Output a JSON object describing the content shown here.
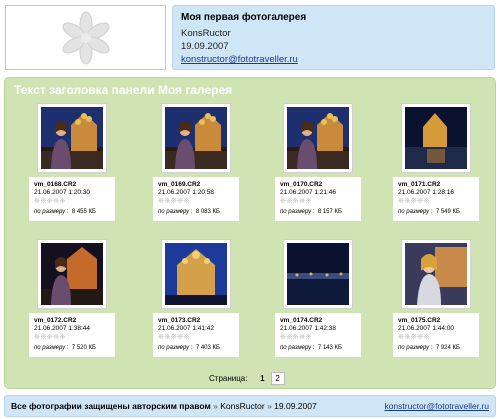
{
  "header": {
    "title": "Моя первая фотогалерея",
    "author": "KonsRuctor",
    "date": "19.09.2007",
    "email": "konstructor@fototraveller.ru"
  },
  "panel": {
    "title": "Текст заголовка панели Моя галерея",
    "size_label": "по размеру",
    "photos": [
      {
        "name": "vm_0168.CR2",
        "datetime": "21.06.2007 1:20:30",
        "size": "8 455 КБ",
        "scene": "woman-cathedral"
      },
      {
        "name": "vm_0169.CR2",
        "datetime": "21.06.2007 1:20:58",
        "size": "8 083 КБ",
        "scene": "woman-cathedral"
      },
      {
        "name": "vm_0170.CR2",
        "datetime": "21.06.2007 1:21:46",
        "size": "8 157 КБ",
        "scene": "woman-cathedral"
      },
      {
        "name": "vm_0171.CR2",
        "datetime": "21.06.2007 1:28:16",
        "size": "7 549 КБ",
        "scene": "night-canal"
      },
      {
        "name": "vm_0172.CR2",
        "datetime": "21.06.2007 1:38:44",
        "size": "7 520 КБ",
        "scene": "woman-night"
      },
      {
        "name": "vm_0173.CR2",
        "datetime": "21.06.2007 1:41:42",
        "size": "7 403 КБ",
        "scene": "cathedral-blue"
      },
      {
        "name": "vm_0174.CR2",
        "datetime": "21.06.2007 1:42:38",
        "size": "7 143 КБ",
        "scene": "night-river"
      },
      {
        "name": "vm_0175.CR2",
        "datetime": "21.06.2007 1:44:00",
        "size": "7 924 КБ",
        "scene": "woman-bright"
      }
    ],
    "pager": {
      "label": "Страница:",
      "current": "1",
      "next": "2"
    }
  },
  "footer": {
    "copyright": "Все фотографии защищены авторским правом",
    "author": "KonsRuctor",
    "date": "19.09.2007",
    "email": "konstructor@fototraveller.ru",
    "separator": "»"
  },
  "colors": {
    "header_bg": "#cfe6f7",
    "panel_bg": "#cfe3b3",
    "link": "#1a3a8a"
  }
}
